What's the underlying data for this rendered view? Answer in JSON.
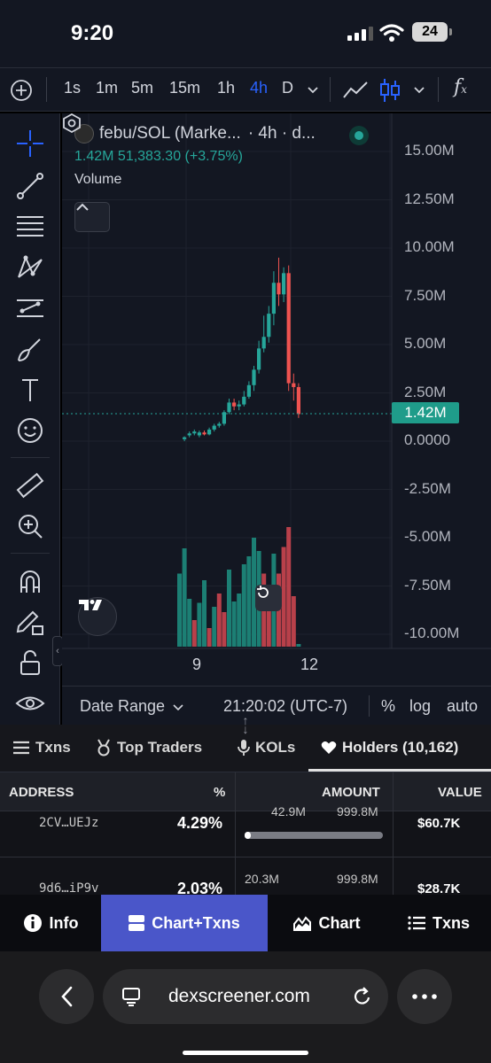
{
  "status_bar": {
    "time": "9:20",
    "battery": "24"
  },
  "toolbar": {
    "intervals": [
      "1s",
      "1m",
      "5m",
      "15m",
      "1h",
      "4h",
      "D"
    ],
    "active_interval": "4h"
  },
  "chart": {
    "pair_title": "febu/SOL (Marke...",
    "timeframe_text": "· 4h · d...",
    "ohlc_line": "1.42M  51,383.30 (+3.75%)",
    "volume_label": "Volume",
    "current_price_tag": "1.42M",
    "y_axis_labels": [
      "15.00M",
      "12.50M",
      "10.00M",
      "7.50M",
      "5.00M",
      "2.50M",
      "0.0000",
      "-2.50M",
      "-5.00M",
      "-7.50M",
      "-10.00M"
    ],
    "x_axis_labels": [
      "9",
      "12"
    ],
    "footer": {
      "date_range": "Date Range",
      "clock": "21:20:02 (UTC-7)",
      "percent": "%",
      "log": "log",
      "auto": "auto"
    },
    "colors": {
      "up": "#26a69a",
      "down": "#ef5350",
      "active": "#2962ff"
    }
  },
  "chart_data": {
    "type": "candlestick",
    "title": "febu/SOL",
    "ylim": [
      -10000000,
      15000000
    ],
    "x_ticks": [
      "9",
      "12"
    ],
    "last_price": 1420000,
    "change": "51,383.30 (+3.75%)",
    "candles": [
      [
        0.1,
        0.2,
        0.0,
        0.25,
        "up"
      ],
      [
        0.3,
        0.4,
        0.2,
        0.5,
        "up"
      ],
      [
        0.4,
        0.5,
        0.3,
        0.6,
        "up"
      ],
      [
        0.3,
        0.45,
        0.2,
        0.55,
        "up"
      ],
      [
        0.45,
        0.35,
        0.3,
        0.55,
        "down"
      ],
      [
        0.35,
        0.6,
        0.3,
        0.7,
        "up"
      ],
      [
        0.6,
        0.8,
        0.5,
        0.9,
        "up"
      ],
      [
        0.8,
        0.9,
        0.7,
        1.0,
        "up"
      ],
      [
        0.9,
        1.5,
        0.8,
        1.6,
        "up"
      ],
      [
        1.5,
        2.0,
        1.4,
        2.2,
        "up"
      ],
      [
        2.0,
        1.8,
        1.6,
        2.2,
        "down"
      ],
      [
        1.8,
        1.9,
        1.6,
        2.1,
        "up"
      ],
      [
        1.9,
        2.3,
        1.8,
        2.6,
        "up"
      ],
      [
        2.3,
        2.9,
        2.2,
        3.1,
        "up"
      ],
      [
        2.9,
        3.7,
        2.6,
        3.9,
        "up"
      ],
      [
        3.7,
        4.8,
        3.5,
        5.2,
        "up"
      ],
      [
        4.8,
        5.4,
        4.6,
        6.5,
        "up"
      ],
      [
        5.4,
        6.6,
        5.1,
        7.0,
        "up"
      ],
      [
        6.6,
        8.2,
        6.0,
        8.8,
        "up"
      ],
      [
        8.2,
        7.6,
        7.0,
        9.5,
        "down"
      ],
      [
        7.6,
        8.7,
        7.2,
        9.0,
        "up"
      ],
      [
        8.7,
        3.0,
        2.6,
        9.1,
        "down"
      ],
      [
        3.0,
        2.8,
        2.1,
        3.5,
        "down"
      ],
      [
        2.8,
        1.4,
        1.2,
        3.0,
        "down"
      ]
    ],
    "candle_fields": [
      "open",
      "close",
      "low",
      "high",
      "direction"
    ],
    "candle_units": "millions",
    "volume_bars": [
      [
        55,
        "up"
      ],
      [
        74,
        "up"
      ],
      [
        36,
        "up"
      ],
      [
        20,
        "down"
      ],
      [
        33,
        "up"
      ],
      [
        50,
        "up"
      ],
      [
        14,
        "down"
      ],
      [
        30,
        "up"
      ],
      [
        40,
        "down"
      ],
      [
        26,
        "down"
      ],
      [
        58,
        "up"
      ],
      [
        34,
        "up"
      ],
      [
        40,
        "up"
      ],
      [
        62,
        "up"
      ],
      [
        68,
        "up"
      ],
      [
        82,
        "up"
      ],
      [
        72,
        "up"
      ],
      [
        55,
        "down"
      ],
      [
        40,
        "down"
      ],
      [
        70,
        "up"
      ],
      [
        55,
        "down"
      ],
      [
        75,
        "down"
      ],
      [
        90,
        "down"
      ],
      [
        38,
        "down"
      ],
      [
        2,
        "up"
      ]
    ],
    "volume_units": "relative %"
  },
  "tabs": [
    {
      "label": "Txns",
      "icon": "list-icon"
    },
    {
      "label": "Top Traders",
      "icon": "medal-icon"
    },
    {
      "label": "KOLs",
      "icon": "mic-icon"
    },
    {
      "label": "Holders (10,162)",
      "icon": "heart-icon"
    }
  ],
  "active_tab": "Holders (10,162)",
  "holders": {
    "columns": [
      "ADDRESS",
      "%",
      "AMOUNT",
      "VALUE"
    ],
    "rows": [
      {
        "address": "2CV…UEJz",
        "percent": "4.29%",
        "amount_top": "42.9M",
        "amount_total": "999.8M",
        "fill": 0.0429,
        "value": "$60.7K"
      },
      {
        "address": "9d6…iP9v",
        "percent": "2.03%",
        "amount_top": "20.3M",
        "amount_total": "999.8M",
        "fill": 0.0203,
        "value": "$28.7K"
      }
    ]
  },
  "bottom_nav": [
    {
      "label": "Info",
      "icon": "info-icon"
    },
    {
      "label": "Chart+Txns",
      "icon": "split-view-icon"
    },
    {
      "label": "Chart",
      "icon": "mountain-chart-icon"
    },
    {
      "label": "Txns",
      "icon": "list-icon"
    }
  ],
  "active_nav": "Chart+Txns",
  "browser": {
    "url": "dexscreener.com"
  }
}
